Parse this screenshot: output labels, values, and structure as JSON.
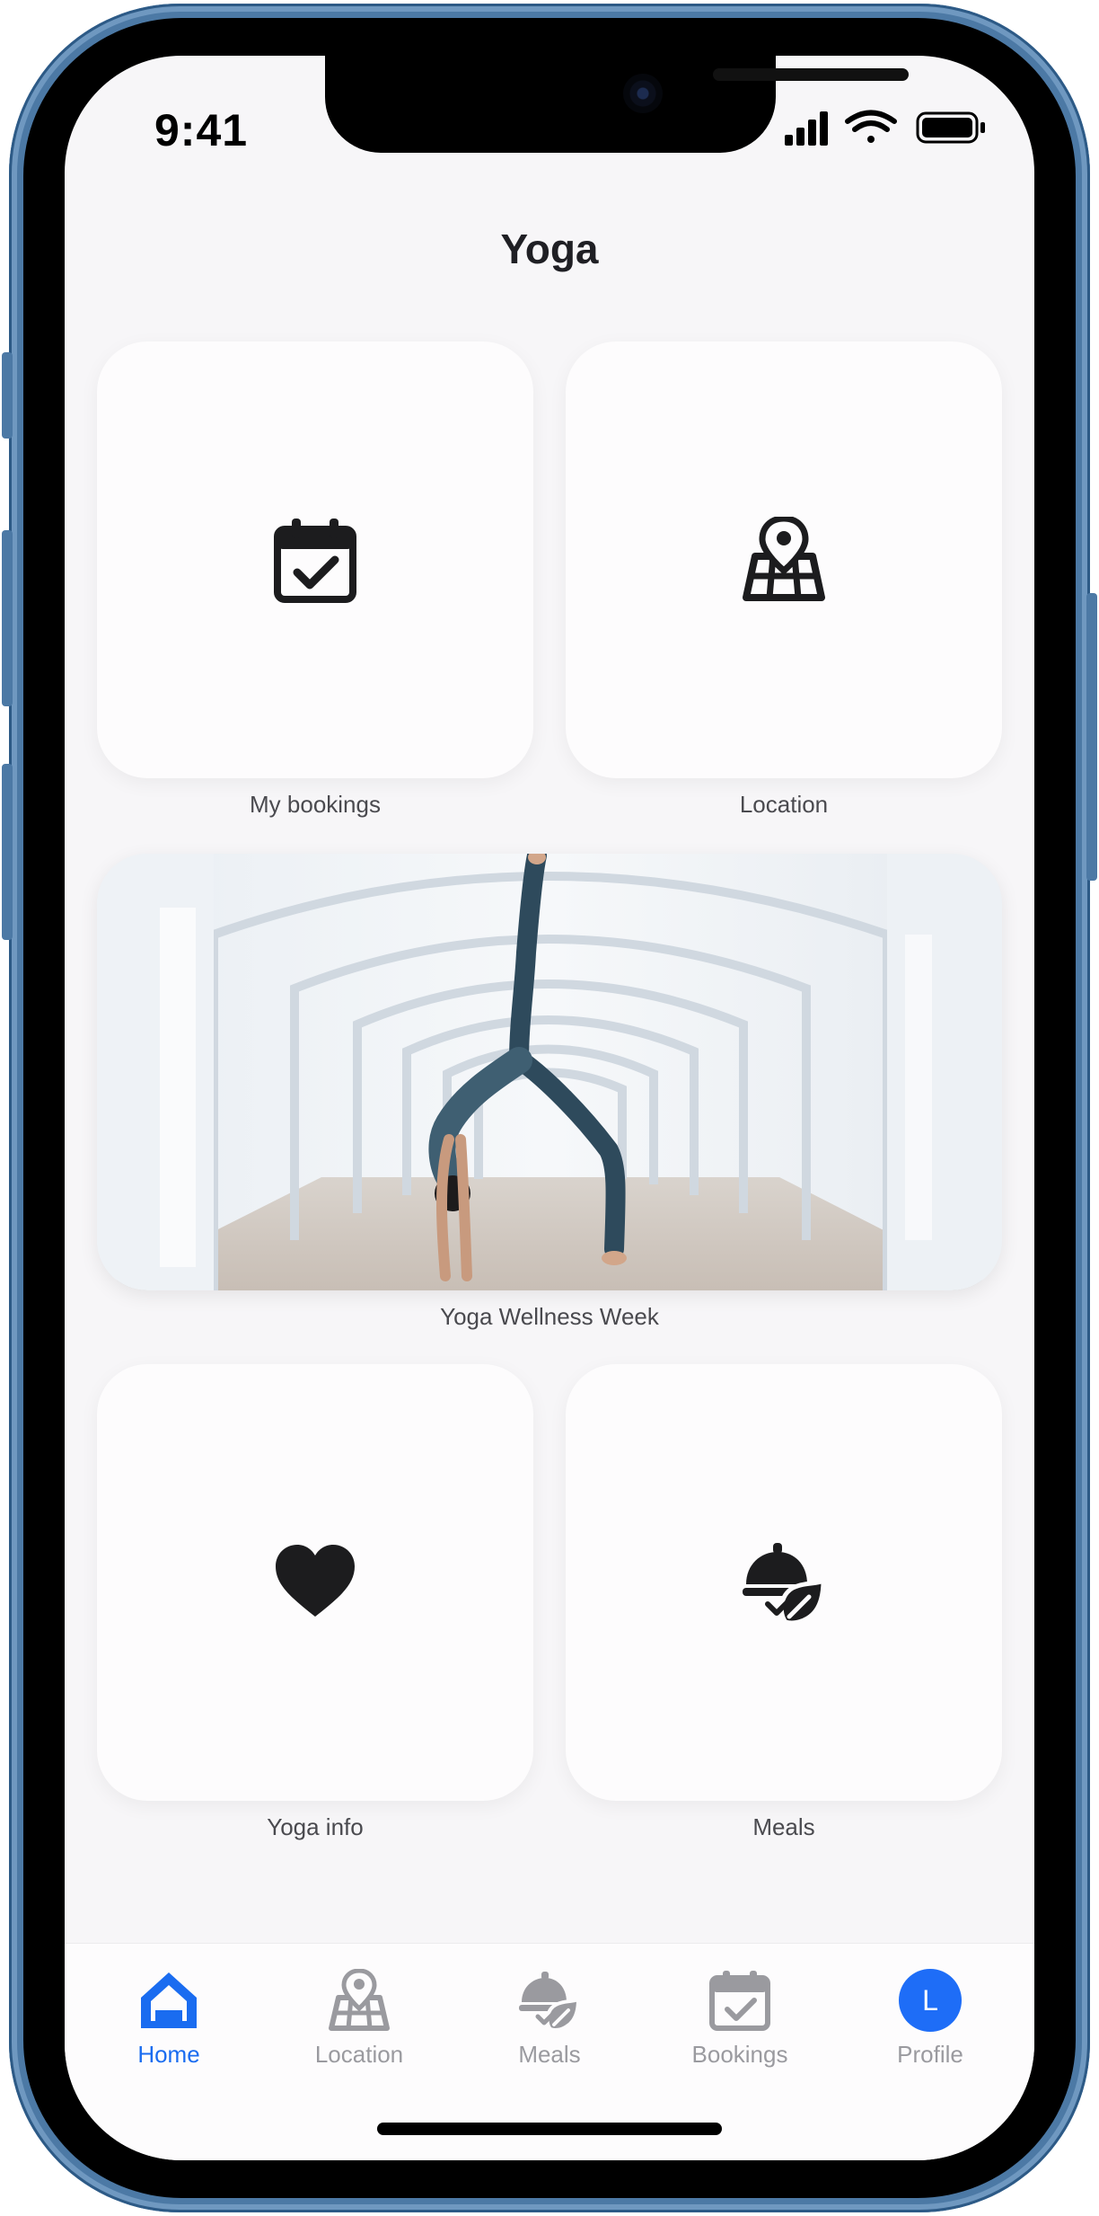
{
  "status_bar": {
    "time": "9:41"
  },
  "page": {
    "title": "Yoga"
  },
  "tiles": {
    "my_bookings": {
      "label": "My bookings",
      "icon": "calendar-check-icon"
    },
    "location": {
      "label": "Location",
      "icon": "map-pin-icon"
    },
    "banner": {
      "label": "Yoga Wellness Week",
      "image": "yoga-pose-photo"
    },
    "yoga_info": {
      "label": "Yoga info",
      "icon": "heart-icon"
    },
    "meals": {
      "label": "Meals",
      "icon": "meal-cloche-leaf-icon"
    }
  },
  "tab_bar": {
    "items": [
      {
        "label": "Home",
        "icon": "home-icon",
        "active": true
      },
      {
        "label": "Location",
        "icon": "map-pin-icon",
        "active": false
      },
      {
        "label": "Meals",
        "icon": "meal-cloche-leaf-icon",
        "active": false
      },
      {
        "label": "Bookings",
        "icon": "calendar-check-icon",
        "active": false
      },
      {
        "label": "Profile",
        "icon": "avatar",
        "active": false,
        "avatar_letter": "L"
      }
    ]
  },
  "colors": {
    "accent": "#1a6cf0",
    "avatar_bg": "#1e6df7",
    "inactive": "#9a9a9f",
    "frame": "#4c79a5"
  }
}
